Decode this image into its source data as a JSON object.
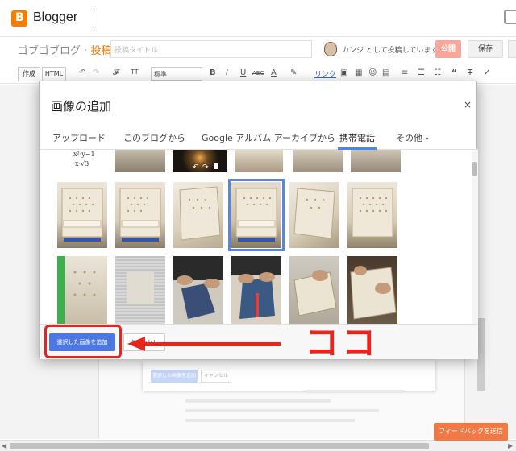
{
  "header": {
    "app_name": "Blogger",
    "logo_letter": "B"
  },
  "postbar": {
    "blog_name": "ゴブゴブログ",
    "separator": "·",
    "mode": "投稿",
    "title_placeholder": "投稿タイトル",
    "author_text": "カンジ として投稿しています",
    "publish_label": "公開",
    "save_label": "保存"
  },
  "toolbar": {
    "compose_label": "作成",
    "html_label": "HTML",
    "font_icon": "𝓕",
    "size_icon": "TT",
    "format_value": "標準",
    "bold": "B",
    "italic": "I",
    "underline": "U",
    "strike": "ABC",
    "text_color": "A",
    "link_label": "リンク",
    "quote": "“",
    "clear": "T"
  },
  "dialog": {
    "title": "画像の追加",
    "close": "×",
    "tabs": [
      {
        "label": "アップロード"
      },
      {
        "label": "このブログから"
      },
      {
        "label": "Google アルバム アーカイブから"
      },
      {
        "label": "携帯電話"
      },
      {
        "label": "その他"
      }
    ],
    "dropdown_caret": "▾",
    "add_selected_label": "選択した画像を追加",
    "cancel_label": "キャンセル"
  },
  "ghost": {
    "add_label": "選択した画像を追加",
    "cancel_label": "キャンセル"
  },
  "annotation": {
    "text": "ココ"
  },
  "feedback": {
    "label": "フィードバックを送信"
  },
  "colors": {
    "brand": "#f57d00",
    "primary_button": "#4d78e4",
    "annotation_red": "#e8241c",
    "selection": "#5a86e0",
    "feedback": "#ef7a45"
  }
}
